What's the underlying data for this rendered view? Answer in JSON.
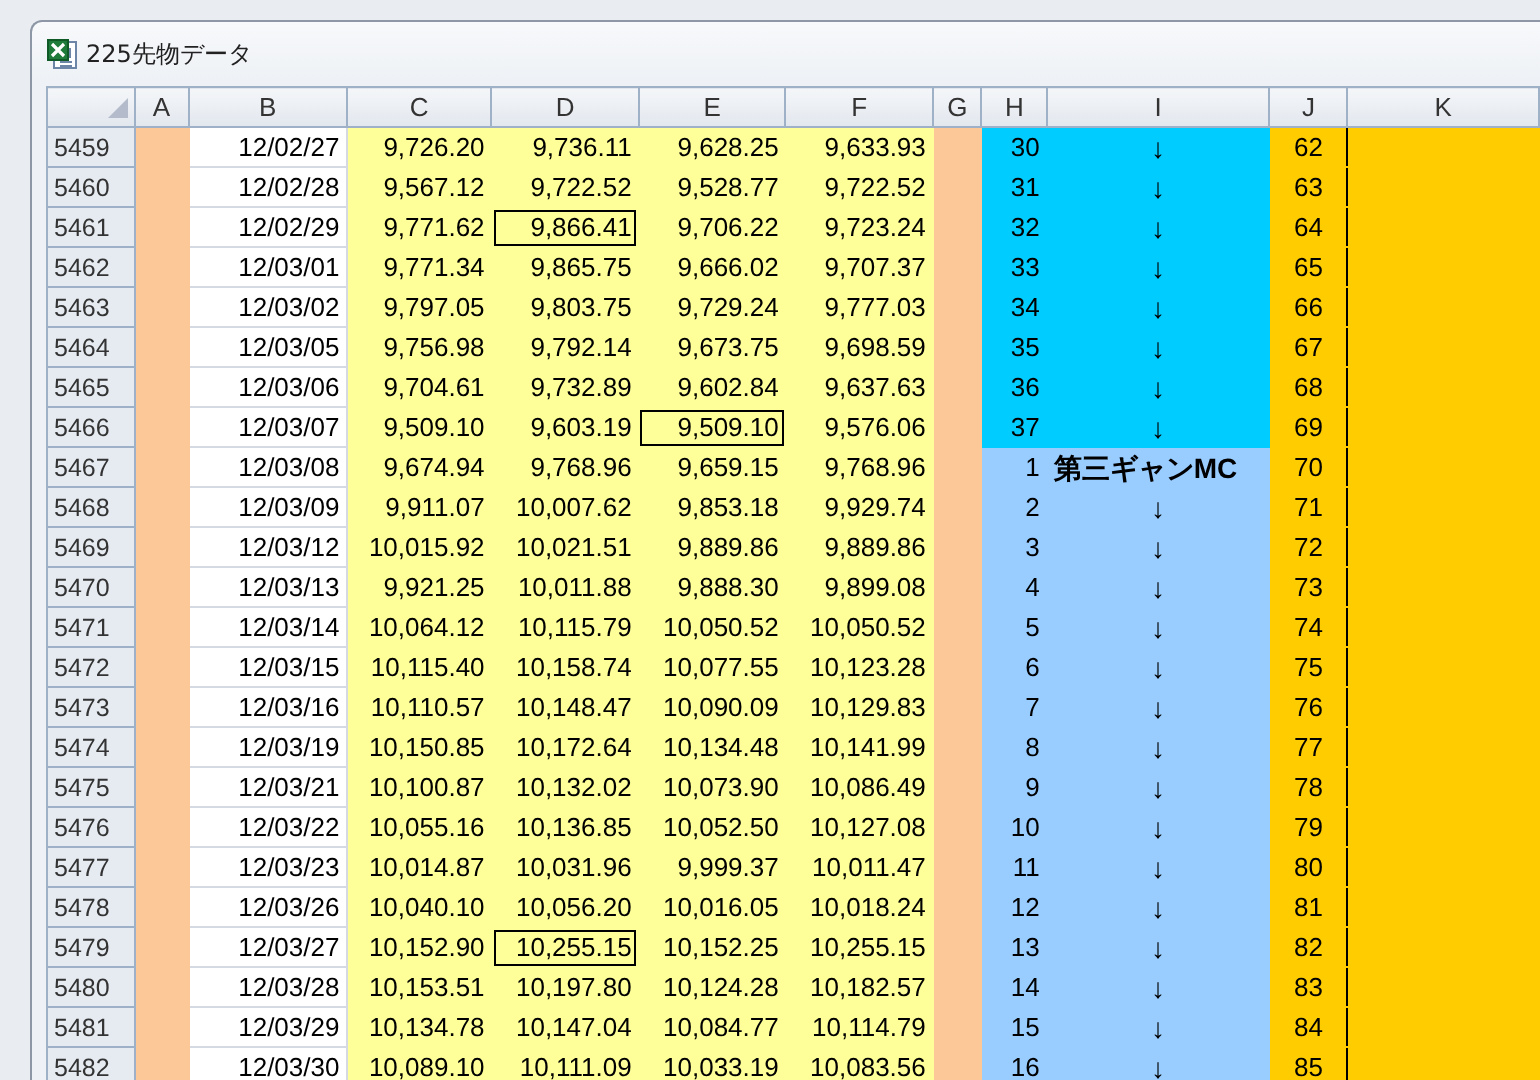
{
  "window": {
    "title": "225先物データ"
  },
  "columns": [
    "A",
    "B",
    "C",
    "D",
    "E",
    "F",
    "G",
    "H",
    "I",
    "J",
    "K"
  ],
  "rows": [
    {
      "num": "5459",
      "date": "12/02/27",
      "prices": [
        "9,726.20",
        "9,736.11",
        "9,628.25",
        "9,633.93"
      ],
      "outlined": [
        false,
        false,
        false,
        false
      ],
      "h": "30",
      "i": "↓",
      "j": "62",
      "color": "#00ccff"
    },
    {
      "num": "5460",
      "date": "12/02/28",
      "prices": [
        "9,567.12",
        "9,722.52",
        "9,528.77",
        "9,722.52"
      ],
      "outlined": [
        false,
        false,
        false,
        false
      ],
      "h": "31",
      "i": "↓",
      "j": "63",
      "color": "#00ccff"
    },
    {
      "num": "5461",
      "date": "12/02/29",
      "prices": [
        "9,771.62",
        "9,866.41",
        "9,706.22",
        "9,723.24"
      ],
      "outlined": [
        false,
        true,
        false,
        false
      ],
      "h": "32",
      "i": "↓",
      "j": "64",
      "color": "#00ccff"
    },
    {
      "num": "5462",
      "date": "12/03/01",
      "prices": [
        "9,771.34",
        "9,865.75",
        "9,666.02",
        "9,707.37"
      ],
      "outlined": [
        false,
        false,
        false,
        false
      ],
      "h": "33",
      "i": "↓",
      "j": "65",
      "color": "#00ccff"
    },
    {
      "num": "5463",
      "date": "12/03/02",
      "prices": [
        "9,797.05",
        "9,803.75",
        "9,729.24",
        "9,777.03"
      ],
      "outlined": [
        false,
        false,
        false,
        false
      ],
      "h": "34",
      "i": "↓",
      "j": "66",
      "color": "#00ccff"
    },
    {
      "num": "5464",
      "date": "12/03/05",
      "prices": [
        "9,756.98",
        "9,792.14",
        "9,673.75",
        "9,698.59"
      ],
      "outlined": [
        false,
        false,
        false,
        false
      ],
      "h": "35",
      "i": "↓",
      "j": "67",
      "color": "#00ccff"
    },
    {
      "num": "5465",
      "date": "12/03/06",
      "prices": [
        "9,704.61",
        "9,732.89",
        "9,602.84",
        "9,637.63"
      ],
      "outlined": [
        false,
        false,
        false,
        false
      ],
      "h": "36",
      "i": "↓",
      "j": "68",
      "color": "#00ccff"
    },
    {
      "num": "5466",
      "date": "12/03/07",
      "prices": [
        "9,509.10",
        "9,603.19",
        "9,509.10",
        "9,576.06"
      ],
      "outlined": [
        false,
        false,
        true,
        false
      ],
      "h": "37",
      "i": "↓",
      "j": "69",
      "color": "#00ccff"
    },
    {
      "num": "5467",
      "date": "12/03/08",
      "prices": [
        "9,674.94",
        "9,768.96",
        "9,659.15",
        "9,768.96"
      ],
      "outlined": [
        false,
        false,
        false,
        false
      ],
      "h": "1",
      "i": "第三ギャンMC",
      "j": "70",
      "color": "#99ccff"
    },
    {
      "num": "5468",
      "date": "12/03/09",
      "prices": [
        "9,911.07",
        "10,007.62",
        "9,853.18",
        "9,929.74"
      ],
      "outlined": [
        false,
        false,
        false,
        false
      ],
      "h": "2",
      "i": "↓",
      "j": "71",
      "color": "#99ccff"
    },
    {
      "num": "5469",
      "date": "12/03/12",
      "prices": [
        "10,015.92",
        "10,021.51",
        "9,889.86",
        "9,889.86"
      ],
      "outlined": [
        false,
        false,
        false,
        false
      ],
      "h": "3",
      "i": "↓",
      "j": "72",
      "color": "#99ccff"
    },
    {
      "num": "5470",
      "date": "12/03/13",
      "prices": [
        "9,921.25",
        "10,011.88",
        "9,888.30",
        "9,899.08"
      ],
      "outlined": [
        false,
        false,
        false,
        false
      ],
      "h": "4",
      "i": "↓",
      "j": "73",
      "color": "#99ccff"
    },
    {
      "num": "5471",
      "date": "12/03/14",
      "prices": [
        "10,064.12",
        "10,115.79",
        "10,050.52",
        "10,050.52"
      ],
      "outlined": [
        false,
        false,
        false,
        false
      ],
      "h": "5",
      "i": "↓",
      "j": "74",
      "color": "#99ccff"
    },
    {
      "num": "5472",
      "date": "12/03/15",
      "prices": [
        "10,115.40",
        "10,158.74",
        "10,077.55",
        "10,123.28"
      ],
      "outlined": [
        false,
        false,
        false,
        false
      ],
      "h": "6",
      "i": "↓",
      "j": "75",
      "color": "#99ccff"
    },
    {
      "num": "5473",
      "date": "12/03/16",
      "prices": [
        "10,110.57",
        "10,148.47",
        "10,090.09",
        "10,129.83"
      ],
      "outlined": [
        false,
        false,
        false,
        false
      ],
      "h": "7",
      "i": "↓",
      "j": "76",
      "color": "#99ccff"
    },
    {
      "num": "5474",
      "date": "12/03/19",
      "prices": [
        "10,150.85",
        "10,172.64",
        "10,134.48",
        "10,141.99"
      ],
      "outlined": [
        false,
        false,
        false,
        false
      ],
      "h": "8",
      "i": "↓",
      "j": "77",
      "color": "#99ccff"
    },
    {
      "num": "5475",
      "date": "12/03/21",
      "prices": [
        "10,100.87",
        "10,132.02",
        "10,073.90",
        "10,086.49"
      ],
      "outlined": [
        false,
        false,
        false,
        false
      ],
      "h": "9",
      "i": "↓",
      "j": "78",
      "color": "#99ccff"
    },
    {
      "num": "5476",
      "date": "12/03/22",
      "prices": [
        "10,055.16",
        "10,136.85",
        "10,052.50",
        "10,127.08"
      ],
      "outlined": [
        false,
        false,
        false,
        false
      ],
      "h": "10",
      "i": "↓",
      "j": "79",
      "color": "#99ccff"
    },
    {
      "num": "5477",
      "date": "12/03/23",
      "prices": [
        "10,014.87",
        "10,031.96",
        "9,999.37",
        "10,011.47"
      ],
      "outlined": [
        false,
        false,
        false,
        false
      ],
      "h": "11",
      "i": "↓",
      "j": "80",
      "color": "#99ccff"
    },
    {
      "num": "5478",
      "date": "12/03/26",
      "prices": [
        "10,040.10",
        "10,056.20",
        "10,016.05",
        "10,018.24"
      ],
      "outlined": [
        false,
        false,
        false,
        false
      ],
      "h": "12",
      "i": "↓",
      "j": "81",
      "color": "#99ccff"
    },
    {
      "num": "5479",
      "date": "12/03/27",
      "prices": [
        "10,152.90",
        "10,255.15",
        "10,152.25",
        "10,255.15"
      ],
      "outlined": [
        false,
        true,
        false,
        false
      ],
      "h": "13",
      "i": "↓",
      "j": "82",
      "color": "#99ccff"
    },
    {
      "num": "5480",
      "date": "12/03/28",
      "prices": [
        "10,153.51",
        "10,197.80",
        "10,124.28",
        "10,182.57"
      ],
      "outlined": [
        false,
        false,
        false,
        false
      ],
      "h": "14",
      "i": "↓",
      "j": "83",
      "color": "#99ccff"
    },
    {
      "num": "5481",
      "date": "12/03/29",
      "prices": [
        "10,134.78",
        "10,147.04",
        "10,084.77",
        "10,114.79"
      ],
      "outlined": [
        false,
        false,
        false,
        false
      ],
      "h": "15",
      "i": "↓",
      "j": "84",
      "color": "#99ccff"
    },
    {
      "num": "5482",
      "date": "12/03/30",
      "prices": [
        "10,089.10",
        "10,111.09",
        "10,033.19",
        "10,083.56"
      ],
      "outlined": [
        false,
        false,
        false,
        false
      ],
      "h": "16",
      "i": "↓",
      "j": "85",
      "color": "#99ccff"
    }
  ]
}
